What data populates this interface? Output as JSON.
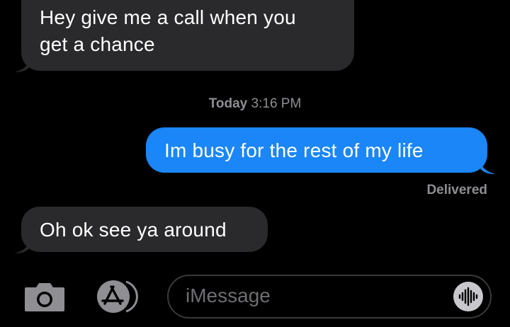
{
  "messages": [
    {
      "direction": "incoming",
      "text_line1": "Hey give me a call when you",
      "text_line2": "get a chance"
    },
    {
      "direction": "outgoing",
      "text": "Im busy for the rest of my life"
    },
    {
      "direction": "incoming",
      "text": "Oh ok see ya around"
    }
  ],
  "timestamp": {
    "day": "Today",
    "time": "3:16 PM"
  },
  "status": "Delivered",
  "input": {
    "placeholder": "iMessage"
  },
  "icons": {
    "camera": "camera-icon",
    "app_store": "app-store-icon",
    "voice": "audio-waveform-icon"
  },
  "colors": {
    "incoming_bubble": "#2a2a2c",
    "outgoing_bubble": "#1a86f7",
    "secondary_text": "#8e8e93",
    "background": "#000000"
  }
}
